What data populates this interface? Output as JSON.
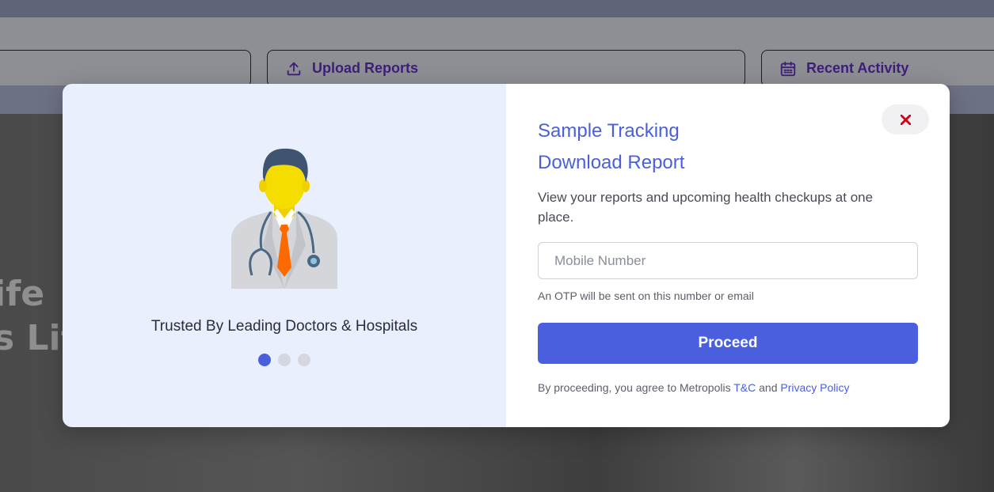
{
  "background": {
    "nav": [
      {
        "label": "",
        "icon": ""
      },
      {
        "label": "Upload Reports",
        "icon": "upload-icon"
      },
      {
        "label": "Recent Activity",
        "icon": "calendar-icon"
      }
    ],
    "hero_line1": "ife",
    "hero_line2": "s Lif"
  },
  "modal": {
    "left": {
      "illustration": "doctor-illustration",
      "tagline": "Trusted By Leading Doctors & Hospitals",
      "carousel_total": 3,
      "carousel_active": 1
    },
    "right": {
      "title_line1": "Sample Tracking",
      "title_line2": "Download Report",
      "subtitle": "View your reports and upcoming health checkups at one place.",
      "mobile_input": {
        "value": "",
        "placeholder": "Mobile Number"
      },
      "otp_note": "An OTP will be sent on this number or email",
      "proceed_label": "Proceed",
      "consent_prefix": "By proceeding, you agree to Metropolis",
      "consent_tc": "T&C",
      "consent_and": "and",
      "consent_privacy": "Privacy Policy",
      "close_icon": "close-icon"
    }
  },
  "colors": {
    "accent": "#4a5fdd",
    "close": "#d0021b",
    "left_panel": "#e9effc"
  }
}
